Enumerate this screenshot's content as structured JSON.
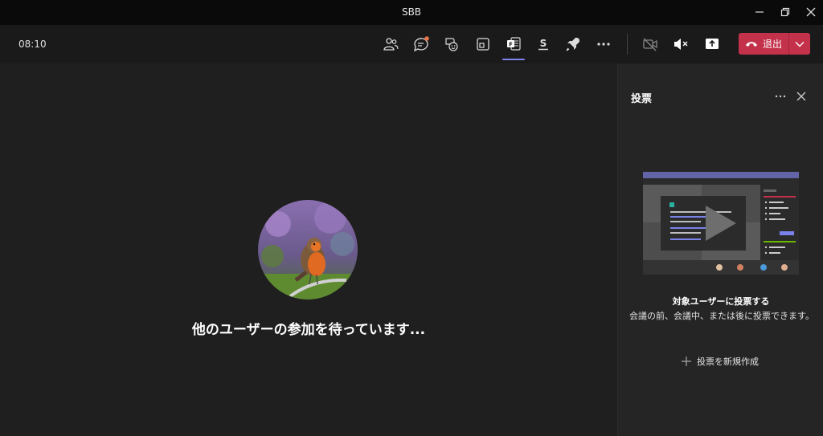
{
  "window": {
    "title": "SBB"
  },
  "toolbar": {
    "timer": "08:10",
    "leave_label": "退出"
  },
  "stage": {
    "waiting_text": "他のユーザーの参加を待っています..."
  },
  "panel": {
    "title": "投票",
    "poll_title": "対象ユーザーに投票する",
    "poll_desc": "会議の前、会議中、または後に投票できます。",
    "new_poll_label": "投票を新規作成"
  },
  "colors": {
    "accent": "#7b83eb",
    "leave": "#c4314b",
    "notification": "#e97548"
  }
}
